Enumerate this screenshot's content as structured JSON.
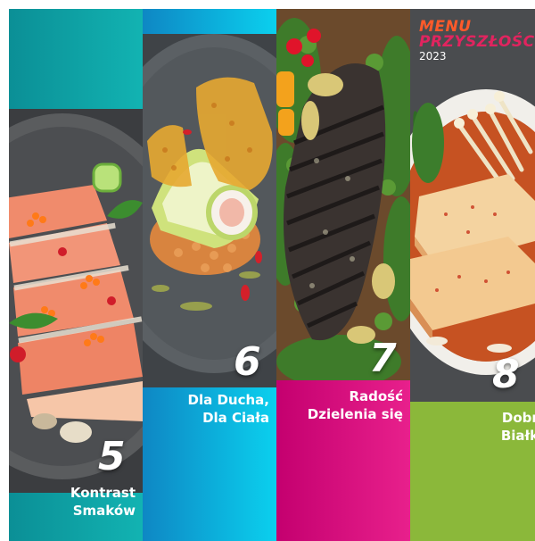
{
  "brand": {
    "line1": "MENU",
    "line2": "PRZYSZŁOŚCI",
    "year": "2023"
  },
  "panels": [
    {
      "number": "5",
      "title_line1": "Kontrast",
      "title_line2": "Smaków",
      "label_color": "#0aa3a7",
      "dish": "salmon-tataki-photo"
    },
    {
      "number": "6",
      "title_line1": "Dla Ducha,",
      "title_line2": "Dla Ciała",
      "label_color": "#0ab8dd",
      "dish": "fish-roll-photo"
    },
    {
      "number": "7",
      "title_line1": "Radość",
      "title_line2": "Dzielenia się",
      "label_color": "#e2137c",
      "dish": "grilled-fish-photo"
    },
    {
      "number": "8",
      "title_line1": "Dobre",
      "title_line2": "Białko",
      "label_color": "#8bb83a",
      "dish": "tofu-broth-photo"
    }
  ]
}
